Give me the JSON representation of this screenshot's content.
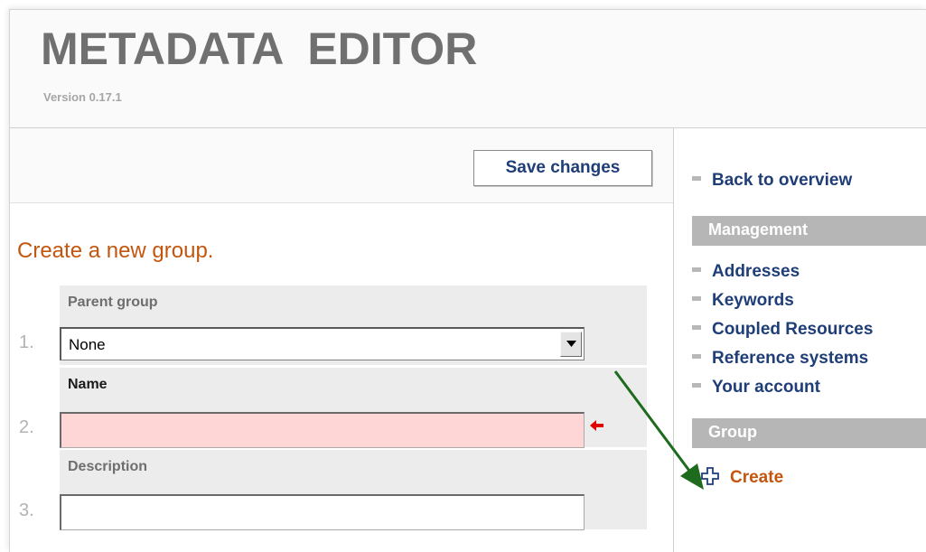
{
  "header": {
    "title": "METADATA  EDITOR",
    "version": "Version 0.17.1"
  },
  "toolbar": {
    "save_label": "Save changes"
  },
  "form": {
    "title": "Create a new group.",
    "fields": [
      {
        "number": "1.",
        "label": "Parent group",
        "type": "select",
        "value": "None"
      },
      {
        "number": "2.",
        "label": "Name",
        "type": "text",
        "value": "",
        "required": true,
        "invalid": true
      },
      {
        "number": "3.",
        "label": "Description",
        "type": "text",
        "value": ""
      }
    ]
  },
  "sidebar": {
    "back_link": "Back to overview",
    "management": {
      "header": "Management",
      "items": [
        {
          "label": "Addresses"
        },
        {
          "label": "Keywords"
        },
        {
          "label": "Coupled Resources"
        },
        {
          "label": "Reference systems"
        },
        {
          "label": "Your account"
        }
      ]
    },
    "group": {
      "header": "Group",
      "create_label": "Create"
    }
  },
  "icons": {
    "select_arrow": "triangle-down-icon",
    "required_marker": "left-arrow-icon",
    "annotation": "diagonal-arrow-icon",
    "create": "plus-icon",
    "bullet": "square-bullet-icon"
  },
  "colors": {
    "accent_orange": "#c3560e",
    "link_blue": "#1f3e78",
    "invalid_field": "#ffd6d6",
    "section_header": "#b6b6b6",
    "annotation_arrow": "#1e6b1e",
    "required_marker": "#e00000"
  }
}
